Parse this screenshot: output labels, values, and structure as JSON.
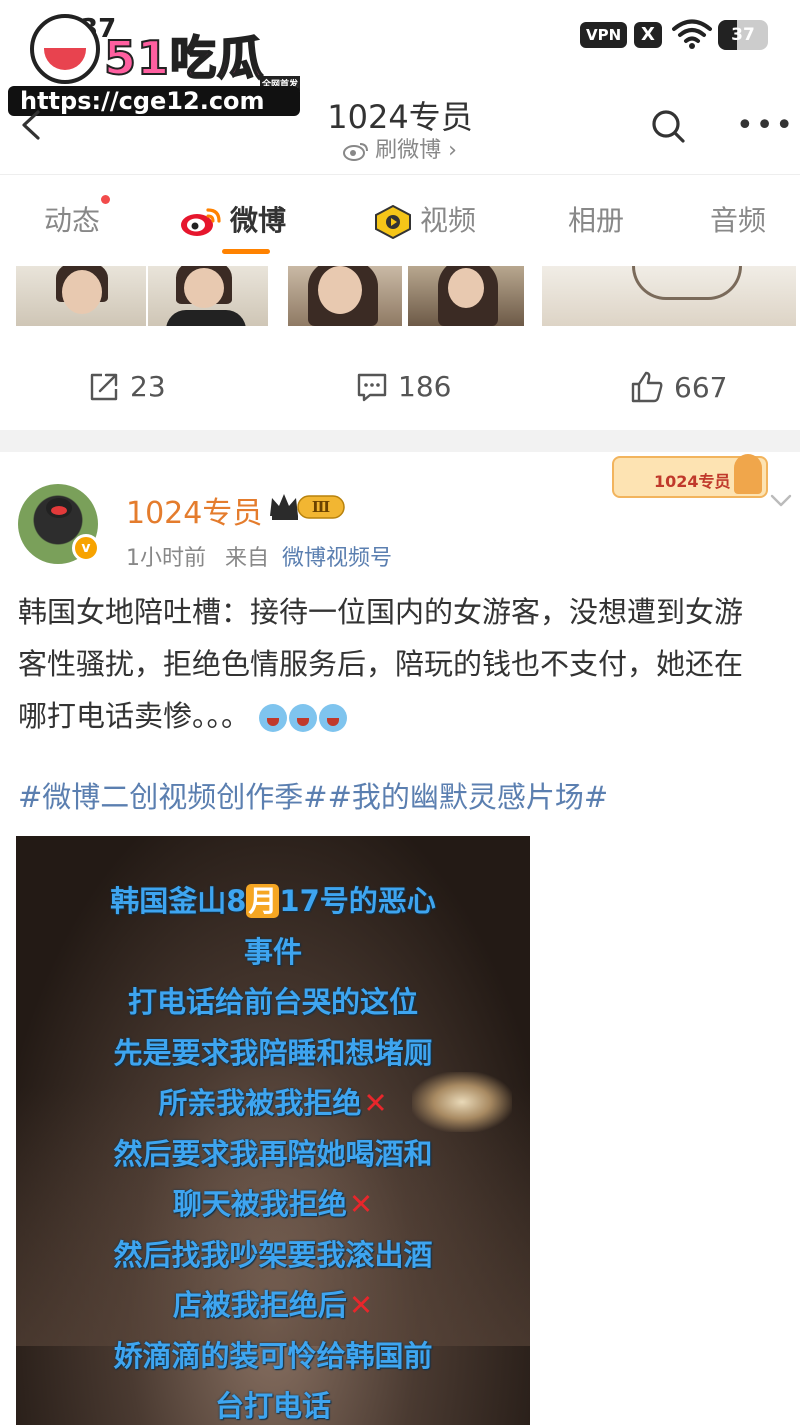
{
  "status_bar": {
    "time": "37",
    "vpn": "VPN",
    "x_badge": "X",
    "battery": "37",
    "battery_level": 0.37
  },
  "watermark": {
    "brand": "51吃瓜",
    "tag": "全网首发",
    "url": "https://cge12.com"
  },
  "header": {
    "title": "1024专员",
    "subtitle": "刷微博 ›"
  },
  "tabs": [
    {
      "label": "动态",
      "has_dot": true,
      "icon": null,
      "active": false
    },
    {
      "label": "微博",
      "has_dot": false,
      "icon": "weibo-logo-icon",
      "active": true
    },
    {
      "label": "视频",
      "has_dot": false,
      "icon": "video-play-icon",
      "active": false
    },
    {
      "label": "相册",
      "has_dot": false,
      "icon": null,
      "active": false
    },
    {
      "label": "音频",
      "has_dot": false,
      "icon": null,
      "active": false
    }
  ],
  "prev_post_actions": {
    "repost_count": "23",
    "comment_count": "186",
    "like_count": "667"
  },
  "post": {
    "username": "1024专员",
    "member_badge": "Ⅲ",
    "decoration_text": "1024专员",
    "time": "1小时前",
    "source_prefix": "来自",
    "source": "微博视频号",
    "text_lines": [
      "韩国女地陪吐槽：接待一位国内的女游客，没想遭到女游",
      "客性骚扰，拒绝色情服务后，陪玩的钱也不支付，她还在",
      "哪打电话卖惨。。。"
    ],
    "topics": "#微博二创视频创作季##我的幽默灵感片场#"
  },
  "video": {
    "line1_pre": "韩国釜山8",
    "line1_month": "月",
    "line1_post": "17号的恶心",
    "line2": "事件",
    "line3": "打电话给前台哭的这位",
    "line4": "先是要求我陪睡和想堵厕",
    "line5": "所亲我被我拒绝",
    "line6": "然后要求我再陪她喝酒和",
    "line7": "聊天被我拒绝",
    "line8": "然后找我吵架要我滚出酒",
    "line9": "店被我拒绝后",
    "line10": "娇滴滴的装可怜给韩国前",
    "line11": "台打电话",
    "x_mark": "✕"
  },
  "colors": {
    "accent": "#ff8200",
    "username": "#e47c2d",
    "link": "#5b7fb0",
    "video_text": "#3ea5f0",
    "x_mark": "#e8262b"
  }
}
